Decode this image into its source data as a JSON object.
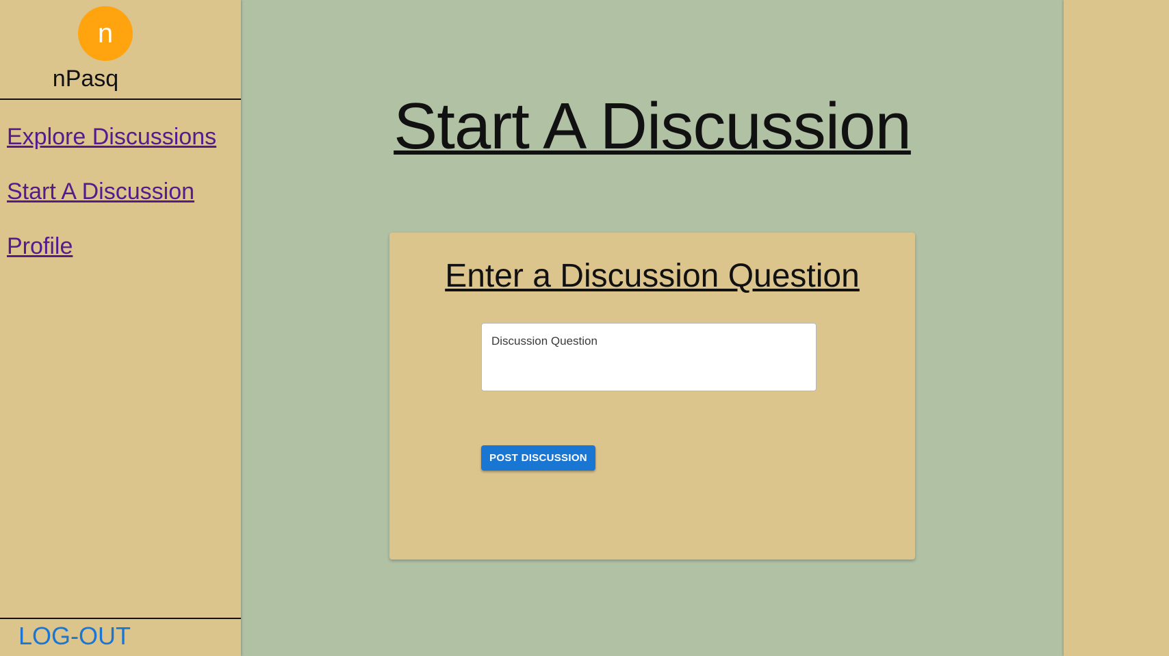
{
  "user": {
    "avatar_initial": "n",
    "username": "nPasq",
    "avatar_color": "#ffa30f"
  },
  "sidebar": {
    "items": [
      {
        "label": "Explore Discussions"
      },
      {
        "label": "Start A Discussion"
      },
      {
        "label": "Profile"
      }
    ],
    "logout_label": "LOG-OUT"
  },
  "main": {
    "title": "Start A Discussion",
    "card": {
      "heading": "Enter a Discussion Question",
      "question_placeholder": "Discussion Question",
      "question_value": "",
      "post_button_label": "POST DISCUSSION"
    }
  },
  "colors": {
    "background": "#b1c1a4",
    "panel": "#dcc48d",
    "link": "#551a8b",
    "accent": "#1976d2"
  }
}
